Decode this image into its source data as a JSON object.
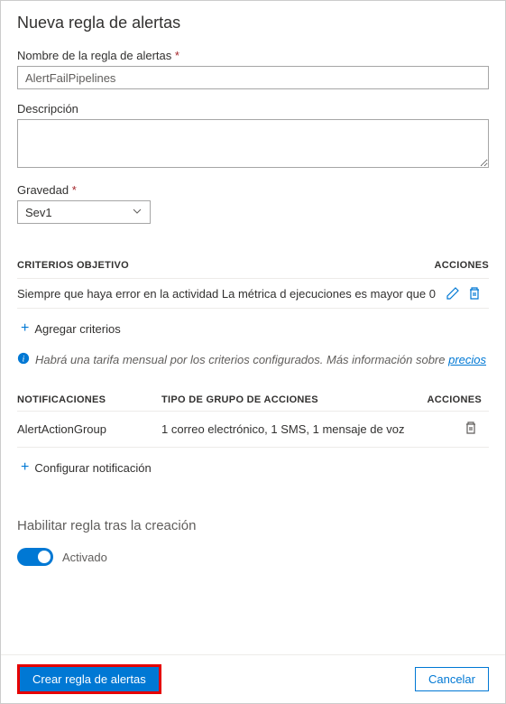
{
  "panel": {
    "title": "Nueva regla de alertas"
  },
  "form": {
    "name_label": "Nombre de la regla de alertas",
    "name_value": "AlertFailPipelines",
    "description_label": "Descripción",
    "description_value": "",
    "severity_label": "Gravedad",
    "severity_value": "Sev1"
  },
  "criteria": {
    "header": "CRITERIOS OBJETIVO",
    "actions_header": "ACCIONES",
    "text": "Siempre que haya error en la actividad La métrica d ejecuciones es mayor que 0",
    "add_label": "Agregar criterios"
  },
  "info": {
    "text": "Habrá una tarifa mensual por los criterios configurados. Más información sobre ",
    "link": "precios"
  },
  "notifications": {
    "header_name": "NOTIFICACIONES",
    "header_type": "TIPO DE GRUPO DE ACCIONES",
    "header_actions": "ACCIONES",
    "rows": [
      {
        "name": "AlertActionGroup",
        "type": "1 correo electrónico, 1 SMS, 1 mensaje de voz"
      }
    ],
    "add_label": "Configurar notificación"
  },
  "enable": {
    "title": "Habilitar regla tras la creación",
    "label": "Activado"
  },
  "footer": {
    "create": "Crear regla de alertas",
    "cancel": "Cancelar"
  }
}
